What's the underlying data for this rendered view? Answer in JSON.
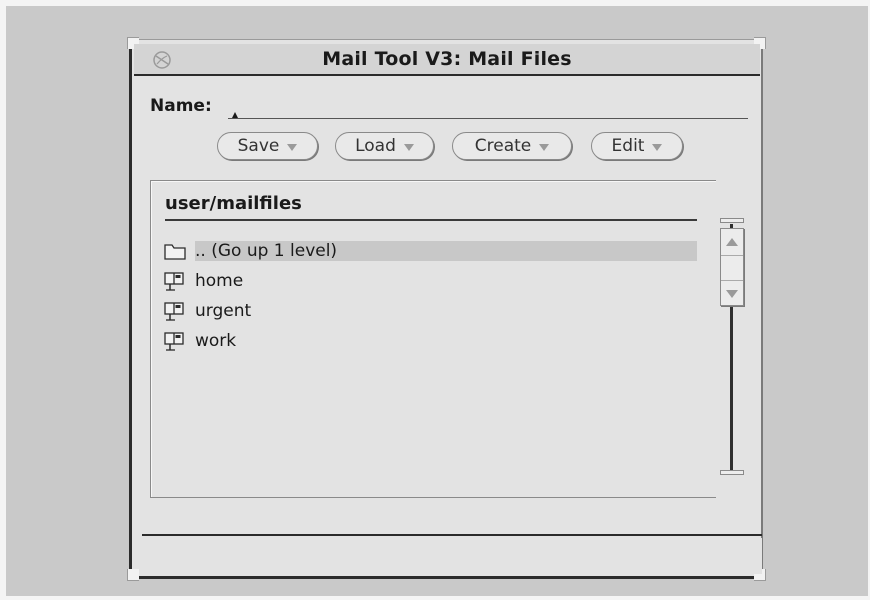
{
  "window": {
    "title": "Mail Tool V3: Mail Files"
  },
  "name_field": {
    "label": "Name:",
    "value": ""
  },
  "buttons": [
    {
      "label": "Save"
    },
    {
      "label": "Load"
    },
    {
      "label": "Create"
    },
    {
      "label": "Edit"
    }
  ],
  "list": {
    "header": "user/mailfiles",
    "items": [
      {
        "label": ".. (Go up 1 level)",
        "icon": "folder-icon",
        "selected": true
      },
      {
        "label": "home",
        "icon": "mailbox-icon",
        "selected": false
      },
      {
        "label": "urgent",
        "icon": "mailbox-icon",
        "selected": false
      },
      {
        "label": "work",
        "icon": "mailbox-icon",
        "selected": false
      }
    ]
  },
  "colors": {
    "background": "#cccccc",
    "window": "#e3e3e3",
    "selection": "#c8c8c8"
  }
}
